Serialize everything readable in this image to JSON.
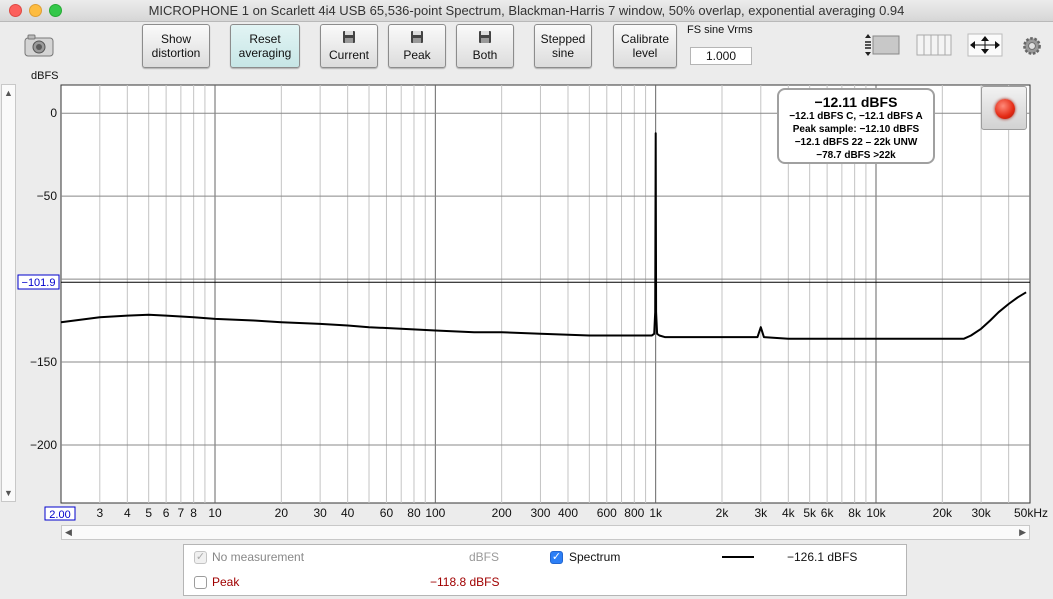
{
  "window": {
    "title": "MICROPHONE 1 on Scarlett 4i4 USB 65,536-point Spectrum, Blackman-Harris 7 window, 50% overlap, exponential averaging 0.94"
  },
  "toolbar": {
    "show_distortion": [
      "Show",
      "distortion"
    ],
    "reset_averaging": [
      "Reset",
      "averaging"
    ],
    "current": "Current",
    "peak": "Peak",
    "both": "Both",
    "stepped_sine": [
      "Stepped",
      "sine"
    ],
    "calibrate_level": [
      "Calibrate",
      "level"
    ],
    "fs_label": "FS sine Vrms",
    "fs_value": "1.000"
  },
  "plot": {
    "y_axis_label": "dBFS",
    "cursor_readout": "−101.9",
    "x_start_readout": "2.00"
  },
  "info_box": {
    "main": "−12.11 dBFS",
    "lines": [
      "−12.1 dBFS C, −12.1 dBFS A",
      "Peak sample: −12.10 dBFS",
      "−12.1 dBFS 22 – 22k UNW",
      "−78.7 dBFS >22k"
    ]
  },
  "legend": {
    "no_measurement_label": "No measurement",
    "no_measurement_unit": "dBFS",
    "spectrum_label": "Spectrum",
    "spectrum_value": "−126.1 dBFS",
    "peak_label": "Peak",
    "peak_value": "−118.8 dBFS"
  },
  "colors": {
    "trace": "#000000",
    "peak_text": "#a00000",
    "record_red": "#e42a14",
    "cursor_box": "#0000cc"
  },
  "chart_data": {
    "type": "line",
    "x_scale": "log",
    "xlim": [
      2,
      50000
    ],
    "ylim": [
      -235,
      17
    ],
    "y_ticks": [
      0,
      -50,
      -100,
      -150,
      -200
    ],
    "y_tick_labels": [
      "0",
      "−50",
      "−100",
      "−150",
      "−200"
    ],
    "x_tick_labels": [
      {
        "v": 3,
        "t": "3"
      },
      {
        "v": 4,
        "t": "4"
      },
      {
        "v": 5,
        "t": "5"
      },
      {
        "v": 6,
        "t": "6"
      },
      {
        "v": 7,
        "t": "7"
      },
      {
        "v": 8,
        "t": "8"
      },
      {
        "v": 10,
        "t": "10"
      },
      {
        "v": 20,
        "t": "20"
      },
      {
        "v": 30,
        "t": "30"
      },
      {
        "v": 40,
        "t": "40"
      },
      {
        "v": 60,
        "t": "60"
      },
      {
        "v": 80,
        "t": "80"
      },
      {
        "v": 100,
        "t": "100"
      },
      {
        "v": 200,
        "t": "200"
      },
      {
        "v": 300,
        "t": "300"
      },
      {
        "v": 400,
        "t": "400"
      },
      {
        "v": 600,
        "t": "600"
      },
      {
        "v": 800,
        "t": "800"
      },
      {
        "v": 1000,
        "t": "1k"
      },
      {
        "v": 2000,
        "t": "2k"
      },
      {
        "v": 3000,
        "t": "3k"
      },
      {
        "v": 4000,
        "t": "4k"
      },
      {
        "v": 5000,
        "t": "5k"
      },
      {
        "v": 6000,
        "t": "6k"
      },
      {
        "v": 8000,
        "t": "8k"
      },
      {
        "v": 10000,
        "t": "10k"
      },
      {
        "v": 20000,
        "t": "20k"
      },
      {
        "v": 30000,
        "t": "30k"
      },
      {
        "v": 50000,
        "t": "50kHz"
      }
    ],
    "cursor_level": -101.9,
    "series": [
      {
        "x": [
          2,
          3,
          4,
          5,
          6,
          8,
          10,
          15,
          20,
          30,
          40,
          50,
          70,
          100,
          150,
          200,
          300,
          500,
          700,
          900,
          960,
          985,
          995,
          1000,
          1005,
          1015,
          1040,
          1100,
          1300,
          1500,
          2000,
          2900,
          3000,
          3100,
          4000,
          5000,
          7000,
          9000,
          10000,
          12000,
          15000,
          18000,
          22000,
          25000,
          27000,
          30000,
          33000,
          36000,
          40000,
          44000,
          48000
        ],
        "y": [
          -126,
          -123,
          -122,
          -121.5,
          -122,
          -123,
          -124,
          -125,
          -126,
          -127,
          -128,
          -129,
          -130,
          -131,
          -132,
          -132,
          -133,
          -134,
          -134,
          -134,
          -134,
          -133,
          -120,
          -12.1,
          -120,
          -133,
          -134,
          -135,
          -135,
          -135,
          -135,
          -135,
          -129,
          -135,
          -136,
          -136,
          -136,
          -136,
          -136,
          -136,
          -136,
          -136,
          -136,
          -136,
          -134,
          -130,
          -125,
          -120,
          -115,
          -111,
          -108
        ]
      }
    ]
  }
}
